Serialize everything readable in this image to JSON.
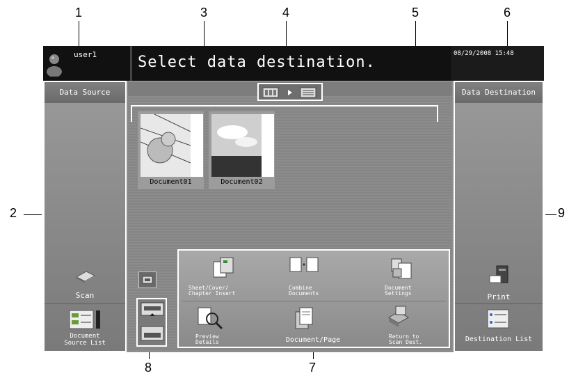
{
  "header": {
    "user": "user1",
    "message": "Select data destination.",
    "datetime": "08/29/2008 15:48"
  },
  "left_panel": {
    "title": "Data Source",
    "scan_label": "Scan",
    "list_label_1": "Document",
    "list_label_2": "Source List"
  },
  "right_panel": {
    "title": "Data Destination",
    "print_label": "Print",
    "list_label": "Destination List"
  },
  "documents": [
    {
      "name": "Document01"
    },
    {
      "name": "Document02"
    }
  ],
  "actions": {
    "sheet_1": "Sheet/Cover/",
    "sheet_2": "Chapter Insert",
    "combine_1": "Combine",
    "combine_2": "Documents",
    "settings_1": "Document",
    "settings_2": "Settings",
    "preview_1": "Preview",
    "preview_2": "Details",
    "docpage": "Document/Page",
    "return_1": "Return to",
    "return_2": "Scan Dest."
  },
  "callouts": [
    "1",
    "2",
    "3",
    "4",
    "5",
    "6",
    "7",
    "8",
    "9"
  ],
  "icons": [
    "user-icon",
    "scanner-icon",
    "document-list-icon",
    "printer-icon",
    "destination-list-icon",
    "view-toggle-icon",
    "scroll-up-icon",
    "scroll-down-icon"
  ]
}
